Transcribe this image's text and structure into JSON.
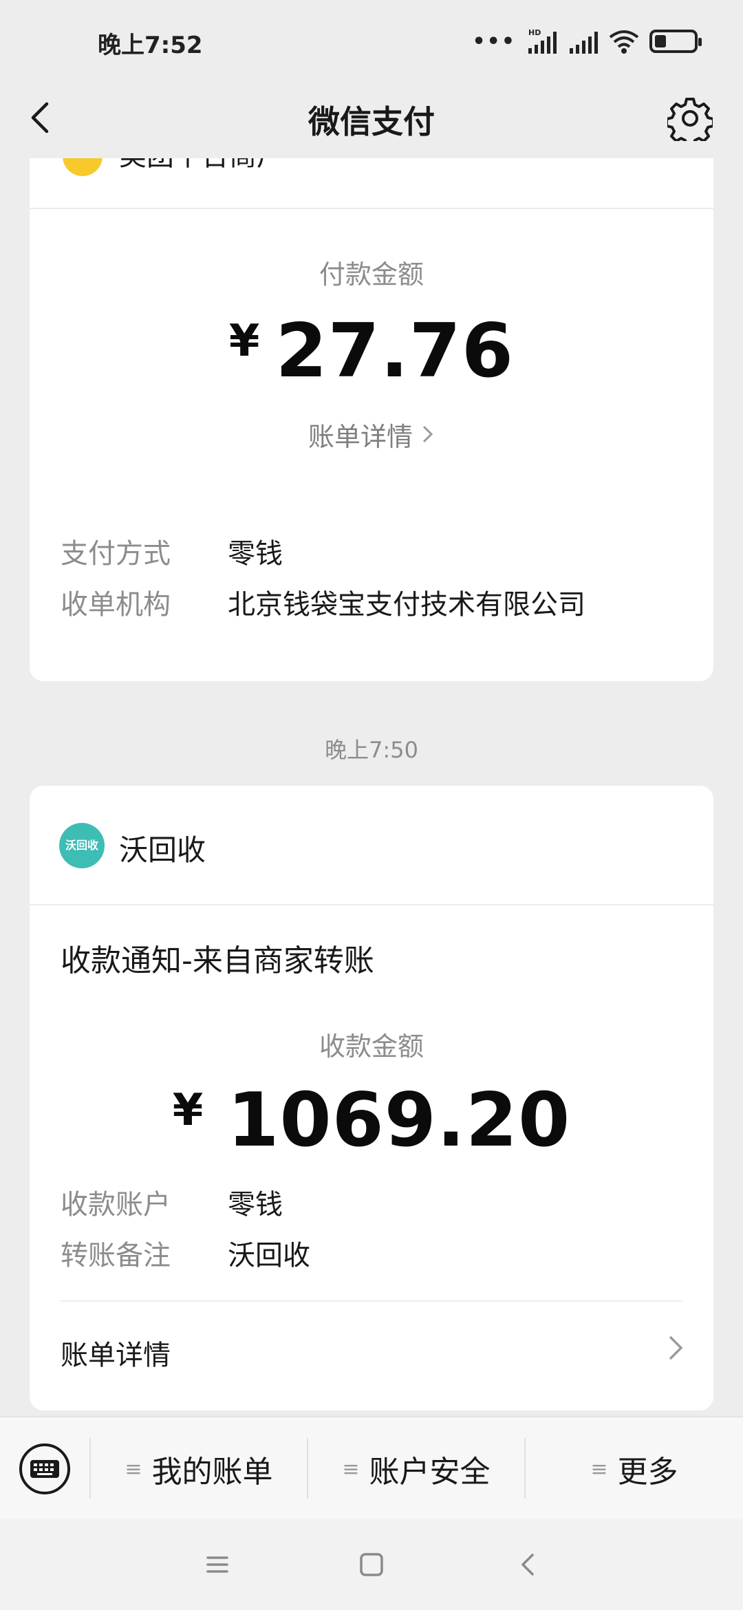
{
  "status": {
    "time": "晚上7:52",
    "dots": "•••",
    "net_badge": "HD"
  },
  "header": {
    "title": "微信支付"
  },
  "card1": {
    "merchant": "美团平台商户",
    "amount_label": "付款金额",
    "currency": "¥",
    "amount": "27.76",
    "detail_link": "账单详情",
    "rows": [
      {
        "label": "支付方式",
        "value": "零钱"
      },
      {
        "label": "收单机构",
        "value": "北京钱袋宝支付技术有限公司"
      }
    ]
  },
  "timestamp": "晚上7:50",
  "card2": {
    "merchant": "沃回收",
    "logo_text": "沃回收",
    "notice_title": "收款通知-来自商家转账",
    "amount_label": "收款金额",
    "currency": "¥",
    "amount": "1069.20",
    "rows": [
      {
        "label": "收款账户",
        "value": "零钱"
      },
      {
        "label": "转账备注",
        "value": "沃回收"
      }
    ],
    "detail_label": "账单详情"
  },
  "bottom_menu": {
    "lines_glyph": "≡",
    "items": [
      "我的账单",
      "账户安全",
      "更多"
    ]
  },
  "colors": {
    "background": "#ededed",
    "card": "#ffffff",
    "teal_logo": "#3dbdb4",
    "yellow_logo": "#f7c92a"
  }
}
